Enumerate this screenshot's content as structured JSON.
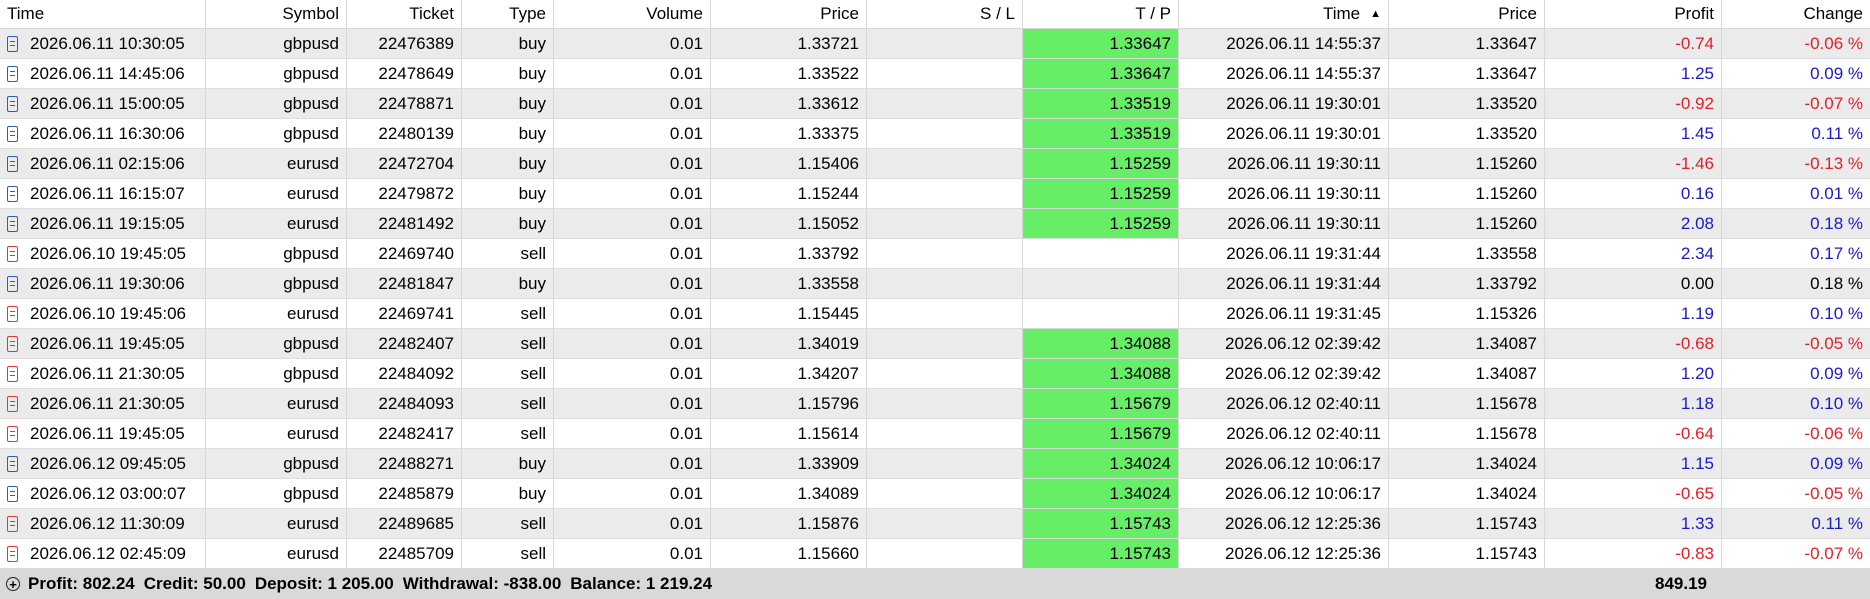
{
  "columns": [
    "Time",
    "Symbol",
    "Ticket",
    "Type",
    "Volume",
    "Price",
    "S / L",
    "T / P",
    "Time",
    "Price",
    "Profit",
    "Change"
  ],
  "sort_indicator": "▲",
  "rows": [
    {
      "open_time": "2026.06.11 10:30:05",
      "symbol": "gbpusd",
      "ticket": "22476389",
      "type": "buy",
      "volume": "0.01",
      "open_price": "1.33721",
      "sl": "",
      "tp": "1.33647",
      "close_time": "2026.06.11 14:55:37",
      "close_price": "1.33647",
      "profit": "-0.74",
      "change": "-0.06 %"
    },
    {
      "open_time": "2026.06.11 14:45:06",
      "symbol": "gbpusd",
      "ticket": "22478649",
      "type": "buy",
      "volume": "0.01",
      "open_price": "1.33522",
      "sl": "",
      "tp": "1.33647",
      "close_time": "2026.06.11 14:55:37",
      "close_price": "1.33647",
      "profit": "1.25",
      "change": "0.09 %"
    },
    {
      "open_time": "2026.06.11 15:00:05",
      "symbol": "gbpusd",
      "ticket": "22478871",
      "type": "buy",
      "volume": "0.01",
      "open_price": "1.33612",
      "sl": "",
      "tp": "1.33519",
      "close_time": "2026.06.11 19:30:01",
      "close_price": "1.33520",
      "profit": "-0.92",
      "change": "-0.07 %"
    },
    {
      "open_time": "2026.06.11 16:30:06",
      "symbol": "gbpusd",
      "ticket": "22480139",
      "type": "buy",
      "volume": "0.01",
      "open_price": "1.33375",
      "sl": "",
      "tp": "1.33519",
      "close_time": "2026.06.11 19:30:01",
      "close_price": "1.33520",
      "profit": "1.45",
      "change": "0.11 %"
    },
    {
      "open_time": "2026.06.11 02:15:06",
      "symbol": "eurusd",
      "ticket": "22472704",
      "type": "buy",
      "volume": "0.01",
      "open_price": "1.15406",
      "sl": "",
      "tp": "1.15259",
      "close_time": "2026.06.11 19:30:11",
      "close_price": "1.15260",
      "profit": "-1.46",
      "change": "-0.13 %"
    },
    {
      "open_time": "2026.06.11 16:15:07",
      "symbol": "eurusd",
      "ticket": "22479872",
      "type": "buy",
      "volume": "0.01",
      "open_price": "1.15244",
      "sl": "",
      "tp": "1.15259",
      "close_time": "2026.06.11 19:30:11",
      "close_price": "1.15260",
      "profit": "0.16",
      "change": "0.01 %"
    },
    {
      "open_time": "2026.06.11 19:15:05",
      "symbol": "eurusd",
      "ticket": "22481492",
      "type": "buy",
      "volume": "0.01",
      "open_price": "1.15052",
      "sl": "",
      "tp": "1.15259",
      "close_time": "2026.06.11 19:30:11",
      "close_price": "1.15260",
      "profit": "2.08",
      "change": "0.18 %"
    },
    {
      "open_time": "2026.06.10 19:45:05",
      "symbol": "gbpusd",
      "ticket": "22469740",
      "type": "sell",
      "volume": "0.01",
      "open_price": "1.33792",
      "sl": "",
      "tp": "",
      "close_time": "2026.06.11 19:31:44",
      "close_price": "1.33558",
      "profit": "2.34",
      "change": "0.17 %"
    },
    {
      "open_time": "2026.06.11 19:30:06",
      "symbol": "gbpusd",
      "ticket": "22481847",
      "type": "buy",
      "volume": "0.01",
      "open_price": "1.33558",
      "sl": "",
      "tp": "",
      "close_time": "2026.06.11 19:31:44",
      "close_price": "1.33792",
      "profit": "0.00",
      "change": "0.18 %"
    },
    {
      "open_time": "2026.06.10 19:45:06",
      "symbol": "eurusd",
      "ticket": "22469741",
      "type": "sell",
      "volume": "0.01",
      "open_price": "1.15445",
      "sl": "",
      "tp": "",
      "close_time": "2026.06.11 19:31:45",
      "close_price": "1.15326",
      "profit": "1.19",
      "change": "0.10 %"
    },
    {
      "open_time": "2026.06.11 19:45:05",
      "symbol": "gbpusd",
      "ticket": "22482407",
      "type": "sell",
      "volume": "0.01",
      "open_price": "1.34019",
      "sl": "",
      "tp": "1.34088",
      "close_time": "2026.06.12 02:39:42",
      "close_price": "1.34087",
      "profit": "-0.68",
      "change": "-0.05 %"
    },
    {
      "open_time": "2026.06.11 21:30:05",
      "symbol": "gbpusd",
      "ticket": "22484092",
      "type": "sell",
      "volume": "0.01",
      "open_price": "1.34207",
      "sl": "",
      "tp": "1.34088",
      "close_time": "2026.06.12 02:39:42",
      "close_price": "1.34087",
      "profit": "1.20",
      "change": "0.09 %"
    },
    {
      "open_time": "2026.06.11 21:30:05",
      "symbol": "eurusd",
      "ticket": "22484093",
      "type": "sell",
      "volume": "0.01",
      "open_price": "1.15796",
      "sl": "",
      "tp": "1.15679",
      "close_time": "2026.06.12 02:40:11",
      "close_price": "1.15678",
      "profit": "1.18",
      "change": "0.10 %"
    },
    {
      "open_time": "2026.06.11 19:45:05",
      "symbol": "eurusd",
      "ticket": "22482417",
      "type": "sell",
      "volume": "0.01",
      "open_price": "1.15614",
      "sl": "",
      "tp": "1.15679",
      "close_time": "2026.06.12 02:40:11",
      "close_price": "1.15678",
      "profit": "-0.64",
      "change": "-0.06 %"
    },
    {
      "open_time": "2026.06.12 09:45:05",
      "symbol": "gbpusd",
      "ticket": "22488271",
      "type": "buy",
      "volume": "0.01",
      "open_price": "1.33909",
      "sl": "",
      "tp": "1.34024",
      "close_time": "2026.06.12 10:06:17",
      "close_price": "1.34024",
      "profit": "1.15",
      "change": "0.09 %"
    },
    {
      "open_time": "2026.06.12 03:00:07",
      "symbol": "gbpusd",
      "ticket": "22485879",
      "type": "buy",
      "volume": "0.01",
      "open_price": "1.34089",
      "sl": "",
      "tp": "1.34024",
      "close_time": "2026.06.12 10:06:17",
      "close_price": "1.34024",
      "profit": "-0.65",
      "change": "-0.05 %"
    },
    {
      "open_time": "2026.06.12 11:30:09",
      "symbol": "eurusd",
      "ticket": "22489685",
      "type": "sell",
      "volume": "0.01",
      "open_price": "1.15876",
      "sl": "",
      "tp": "1.15743",
      "close_time": "2026.06.12 12:25:36",
      "close_price": "1.15743",
      "profit": "1.33",
      "change": "0.11 %"
    },
    {
      "open_time": "2026.06.12 02:45:09",
      "symbol": "eurusd",
      "ticket": "22485709",
      "type": "sell",
      "volume": "0.01",
      "open_price": "1.15660",
      "sl": "",
      "tp": "1.15743",
      "close_time": "2026.06.12 12:25:36",
      "close_price": "1.15743",
      "profit": "-0.83",
      "change": "-0.07 %"
    }
  ],
  "footer": {
    "profit": "Profit: 802.24",
    "credit": "Credit: 50.00",
    "deposit": "Deposit: 1 205.00",
    "withdrawal": "Withdrawal: -838.00",
    "balance": "Balance: 1 219.24",
    "total": "849.19"
  },
  "colors": {
    "tp_highlight": "#66ef66",
    "negative": "#e0202a",
    "positive": "#1a1ac8",
    "buy_icon": "#2d5fb8",
    "sell_icon": "#d43a3a"
  }
}
